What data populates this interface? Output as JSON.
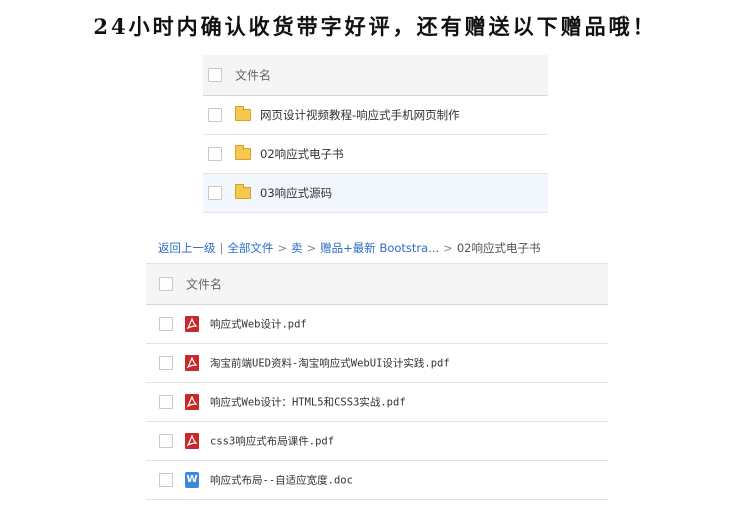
{
  "banner": {
    "text": "24小时内确认收货带字好评，还有赠送以下赠品哦！"
  },
  "folder_table": {
    "header": "文件名",
    "rows": [
      {
        "name": "网页设计视频教程-响应式手机网页制作",
        "icon": "folder-icon",
        "selected": false
      },
      {
        "name": "02响应式电子书",
        "icon": "folder-icon",
        "selected": false
      },
      {
        "name": "03响应式源码",
        "icon": "folder-icon",
        "selected": true
      }
    ]
  },
  "breadcrumb": {
    "back": "返回上一级",
    "all_files": "全部文件",
    "level1": "卖",
    "level2": "赠品+最新 Bootstra...",
    "current": "02响应式电子书",
    "separators": [
      "|",
      ">",
      ">",
      ">"
    ]
  },
  "file_table": {
    "header": "文件名",
    "rows": [
      {
        "name": "响应式Web设计.pdf",
        "icon": "pdf-icon"
      },
      {
        "name": "淘宝前端UED资料-淘宝响应式WebUI设计实践.pdf",
        "icon": "pdf-icon"
      },
      {
        "name": "响应式Web设计：HTML5和CSS3实战.pdf",
        "icon": "pdf-icon"
      },
      {
        "name": "css3响应式布局课件.pdf",
        "icon": "pdf-icon"
      },
      {
        "name": "响应式布局--自适应宽度.doc",
        "icon": "word-icon",
        "icon_letter": "W"
      }
    ]
  },
  "colors": {
    "link": "#2a6ec8",
    "folder": "#f6c94e",
    "pdf": "#c8282a",
    "word": "#3d8ad9",
    "selected_row": "#f2f7fd"
  }
}
